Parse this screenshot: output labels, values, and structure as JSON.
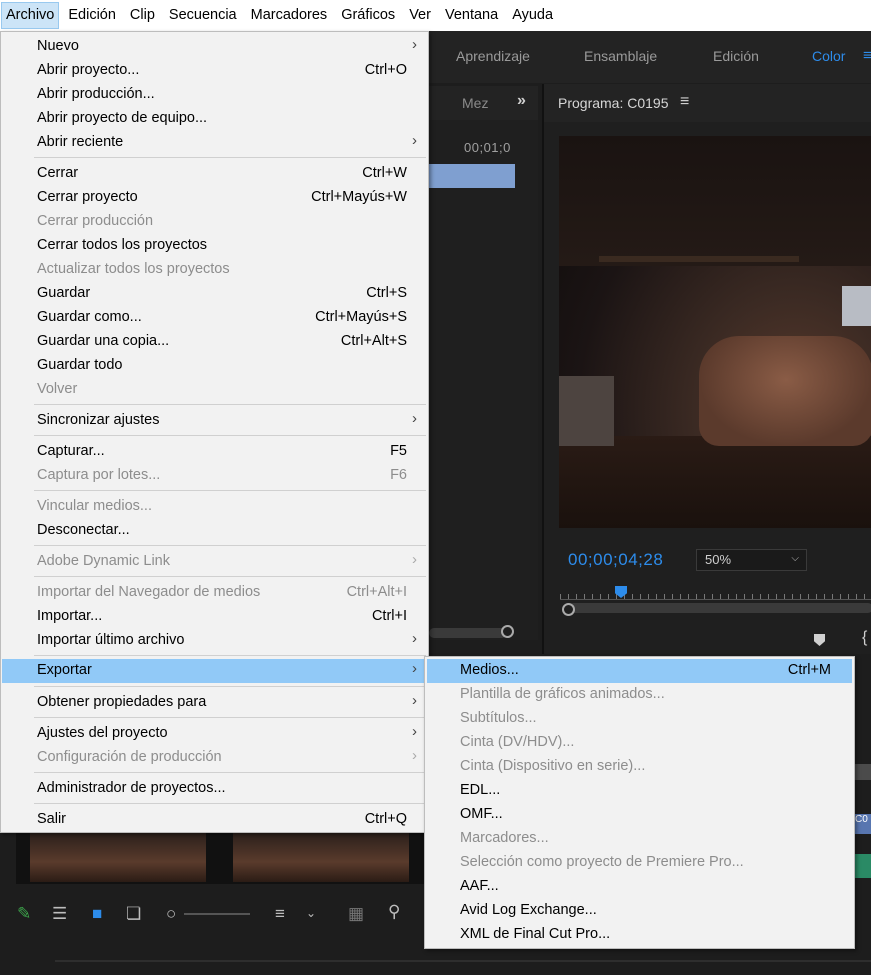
{
  "menubar": {
    "items": [
      "Archivo",
      "Edición",
      "Clip",
      "Secuencia",
      "Marcadores",
      "Gráficos",
      "Ver",
      "Ventana",
      "Ayuda"
    ]
  },
  "workspaces": {
    "tabs": [
      "Aprendizaje",
      "Ensamblaje",
      "Edición",
      "Color"
    ],
    "active": "Color",
    "more": "≡"
  },
  "left_panel": {
    "tab": "Mez",
    "overflow": "»",
    "timecode": "00;01;0"
  },
  "program_monitor": {
    "title": "Programa: C0195",
    "menu_icon": "≡",
    "timecode": "00;00;04;28",
    "zoom": "50%",
    "brace": "{"
  },
  "file_menu": {
    "items": [
      {
        "label": "Nuevo",
        "shortcut": "",
        "submenu": true,
        "disabled": false
      },
      {
        "label": "Abrir proyecto...",
        "shortcut": "Ctrl+O",
        "submenu": false,
        "disabled": false
      },
      {
        "label": "Abrir producción...",
        "shortcut": "",
        "submenu": false,
        "disabled": false
      },
      {
        "label": "Abrir proyecto de equipo...",
        "shortcut": "",
        "submenu": false,
        "disabled": false
      },
      {
        "label": "Abrir reciente",
        "shortcut": "",
        "submenu": true,
        "disabled": false
      },
      {
        "label": "Cerrar",
        "shortcut": "Ctrl+W",
        "submenu": false,
        "disabled": false
      },
      {
        "label": "Cerrar proyecto",
        "shortcut": "Ctrl+Mayús+W",
        "submenu": false,
        "disabled": false
      },
      {
        "label": "Cerrar producción",
        "shortcut": "",
        "submenu": false,
        "disabled": true
      },
      {
        "label": "Cerrar todos los proyectos",
        "shortcut": "",
        "submenu": false,
        "disabled": false
      },
      {
        "label": "Actualizar todos los proyectos",
        "shortcut": "",
        "submenu": false,
        "disabled": true
      },
      {
        "label": "Guardar",
        "shortcut": "Ctrl+S",
        "submenu": false,
        "disabled": false
      },
      {
        "label": "Guardar como...",
        "shortcut": "Ctrl+Mayús+S",
        "submenu": false,
        "disabled": false
      },
      {
        "label": "Guardar una copia...",
        "shortcut": "Ctrl+Alt+S",
        "submenu": false,
        "disabled": false
      },
      {
        "label": "Guardar todo",
        "shortcut": "",
        "submenu": false,
        "disabled": false
      },
      {
        "label": "Volver",
        "shortcut": "",
        "submenu": false,
        "disabled": true
      },
      {
        "label": "Sincronizar ajustes",
        "shortcut": "",
        "submenu": true,
        "disabled": false
      },
      {
        "label": "Capturar...",
        "shortcut": "F5",
        "submenu": false,
        "disabled": false
      },
      {
        "label": "Captura por lotes...",
        "shortcut": "F6",
        "submenu": false,
        "disabled": true
      },
      {
        "label": "Vincular medios...",
        "shortcut": "",
        "submenu": false,
        "disabled": true
      },
      {
        "label": "Desconectar...",
        "shortcut": "",
        "submenu": false,
        "disabled": false
      },
      {
        "label": "Adobe Dynamic Link",
        "shortcut": "",
        "submenu": true,
        "disabled": true
      },
      {
        "label": "Importar del Navegador de medios",
        "shortcut": "Ctrl+Alt+I",
        "submenu": false,
        "disabled": true
      },
      {
        "label": "Importar...",
        "shortcut": "Ctrl+I",
        "submenu": false,
        "disabled": false
      },
      {
        "label": "Importar último archivo",
        "shortcut": "",
        "submenu": true,
        "disabled": false
      },
      {
        "label": "Exportar",
        "shortcut": "",
        "submenu": true,
        "disabled": false,
        "highlighted": true
      },
      {
        "label": "Obtener propiedades para",
        "shortcut": "",
        "submenu": true,
        "disabled": false
      },
      {
        "label": "Ajustes del proyecto",
        "shortcut": "",
        "submenu": true,
        "disabled": false
      },
      {
        "label": "Configuración de producción",
        "shortcut": "",
        "submenu": true,
        "disabled": true
      },
      {
        "label": "Administrador de proyectos...",
        "shortcut": "",
        "submenu": false,
        "disabled": false
      },
      {
        "label": "Salir",
        "shortcut": "Ctrl+Q",
        "submenu": false,
        "disabled": false
      }
    ]
  },
  "export_submenu": {
    "items": [
      {
        "label": "Medios...",
        "shortcut": "Ctrl+M",
        "disabled": false,
        "highlighted": true
      },
      {
        "label": "Plantilla de gráficos animados...",
        "shortcut": "",
        "disabled": true
      },
      {
        "label": "Subtítulos...",
        "shortcut": "",
        "disabled": true
      },
      {
        "label": "Cinta (DV/HDV)...",
        "shortcut": "",
        "disabled": true
      },
      {
        "label": "Cinta (Dispositivo en serie)...",
        "shortcut": "",
        "disabled": true
      },
      {
        "label": "EDL...",
        "shortcut": "",
        "disabled": false
      },
      {
        "label": "OMF...",
        "shortcut": "",
        "disabled": false
      },
      {
        "label": "Marcadores...",
        "shortcut": "",
        "disabled": true
      },
      {
        "label": "Selección como proyecto de Premiere Pro...",
        "shortcut": "",
        "disabled": true
      },
      {
        "label": "AAF...",
        "shortcut": "",
        "disabled": false
      },
      {
        "label": "Avid Log Exchange...",
        "shortcut": "",
        "disabled": false
      },
      {
        "label": "XML de Final Cut Pro...",
        "shortcut": "",
        "disabled": false
      }
    ]
  },
  "right_strip": {
    "clip_label": "C0"
  },
  "colors": {
    "accent": "#2d8ceb",
    "menu_highlight": "#91c9f7",
    "menu_bg": "#f2f2f2"
  }
}
